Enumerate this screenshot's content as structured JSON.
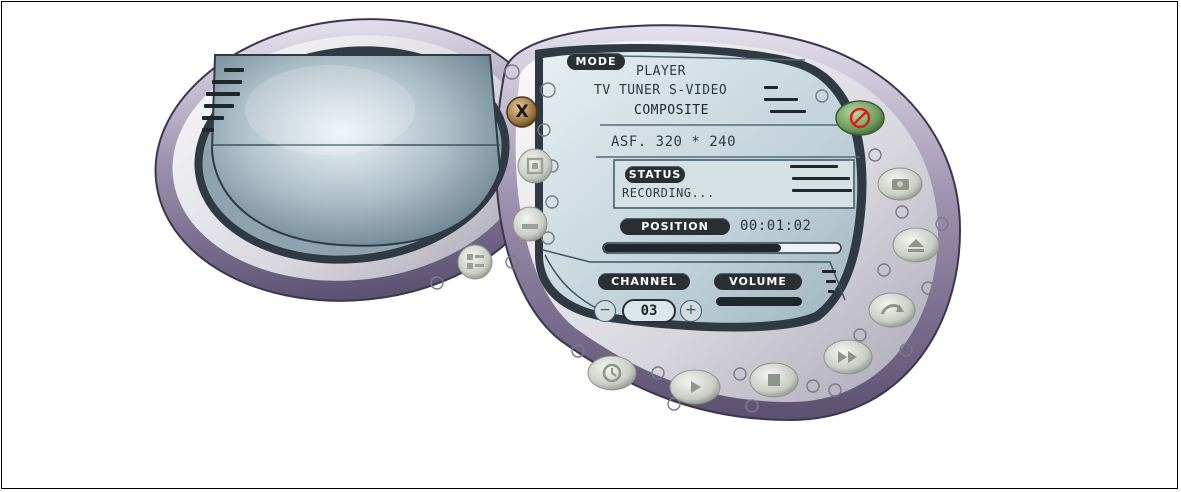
{
  "mode": {
    "label": "MODE",
    "options": [
      "PLAYER",
      "TV TUNER S-VIDEO",
      "COMPOSITE"
    ],
    "format": "ASF. 320 * 240"
  },
  "status": {
    "label": "STATUS",
    "text": "RECORDING..."
  },
  "position": {
    "label": "POSITION",
    "time": "00:01:02",
    "progress": 0.75
  },
  "channel": {
    "label": "CHANNEL",
    "value": "03",
    "minus": "−",
    "plus": "+"
  },
  "volume": {
    "label": "VOLUME"
  },
  "buttons": {
    "close": "X",
    "stop_icon": "no-entry-icon",
    "snapshot_icon": "camera-icon",
    "eject_icon": "eject-icon",
    "repeat_icon": "curved-arrow-icon",
    "fast_forward_icon": "fast-forward-icon",
    "stop_square_icon": "stop-icon",
    "play_icon": "play-icon",
    "timer_icon": "clock-icon",
    "record_icon": "square-icon",
    "minimize_icon": "minimize-icon",
    "settings_icon": "settings-icon"
  },
  "colors": {
    "skin_purple": "#7a6e8e",
    "screen_blue": "#c7d6de",
    "stop_red": "#d8201a",
    "stop_green": "#5f8a4e",
    "close_brown": "#8a6a3c"
  }
}
